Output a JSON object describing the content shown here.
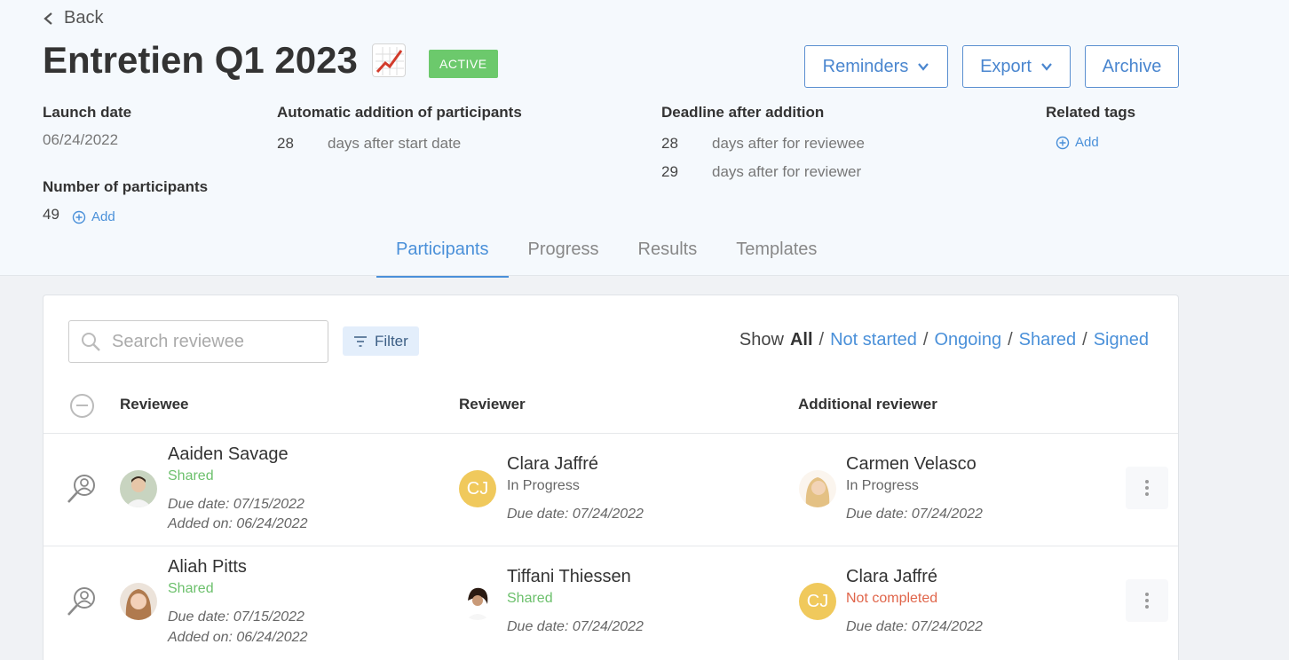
{
  "header": {
    "back_label": "Back",
    "title": "Entretien Q1 2023",
    "status_badge": "ACTIVE",
    "buttons": {
      "reminders": "Reminders",
      "export": "Export",
      "archive": "Archive"
    }
  },
  "meta": {
    "launch_date_label": "Launch date",
    "launch_date": "06/24/2022",
    "participants_label": "Number of participants",
    "participants_count": "49",
    "add_label": "Add",
    "auto_addition_label": "Automatic addition of participants",
    "auto_addition_days": "28",
    "auto_addition_text": "days after start date",
    "deadline_label": "Deadline after addition",
    "deadline_reviewee_days": "28",
    "deadline_reviewee_text": "days after for reviewee",
    "deadline_reviewer_days": "29",
    "deadline_reviewer_text": "days after for reviewer",
    "tags_label": "Related tags"
  },
  "tabs": [
    "Participants",
    "Progress",
    "Results",
    "Templates"
  ],
  "toolbar": {
    "search_placeholder": "Search reviewee",
    "filter_label": "Filter",
    "show_label": "Show",
    "show_all": "All",
    "show_options": [
      "Not started",
      "Ongoing",
      "Shared",
      "Signed"
    ]
  },
  "table": {
    "headers": {
      "reviewee": "Reviewee",
      "reviewer": "Reviewer",
      "additional": "Additional reviewer"
    },
    "rows": [
      {
        "reviewee": {
          "name": "Aaiden Savage",
          "status": "Shared",
          "due": "Due date: 07/15/2022",
          "added": "Added on: 06/24/2022"
        },
        "reviewer": {
          "name": "Clara Jaffré",
          "initials": "CJ",
          "status": "In Progress",
          "due": "Due date: 07/24/2022"
        },
        "additional": {
          "name": "Carmen Velasco",
          "status": "In Progress",
          "due": "Due date: 07/24/2022"
        }
      },
      {
        "reviewee": {
          "name": "Aliah Pitts",
          "status": "Shared",
          "due": "Due date: 07/15/2022",
          "added": "Added on: 06/24/2022"
        },
        "reviewer": {
          "name": "Tiffani Thiessen",
          "status": "Shared",
          "due": "Due date: 07/24/2022"
        },
        "additional": {
          "name": "Clara Jaffré",
          "initials": "CJ",
          "status": "Not completed",
          "due": "Due date: 07/24/2022"
        }
      }
    ]
  },
  "colors": {
    "accent": "#4a90d9",
    "active": "#6cc96c",
    "danger": "#e0654a",
    "avatar_initials_bg": "#f0c95c"
  }
}
